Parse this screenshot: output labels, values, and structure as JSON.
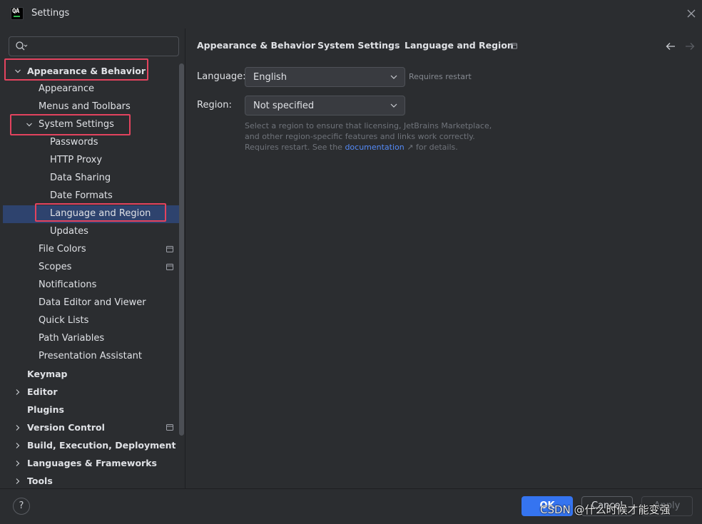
{
  "window": {
    "title": "Settings",
    "app_icon_text": "QA"
  },
  "search": {
    "placeholder": ""
  },
  "tree": [
    {
      "label": "Appearance & Behavior",
      "bold": true,
      "expanded": true
    },
    {
      "label": "Appearance"
    },
    {
      "label": "Menus and Toolbars"
    },
    {
      "label": "System Settings",
      "expanded": true
    },
    {
      "label": "Passwords"
    },
    {
      "label": "HTTP Proxy"
    },
    {
      "label": "Data Sharing"
    },
    {
      "label": "Date Formats"
    },
    {
      "label": "Language and Region",
      "selected": true
    },
    {
      "label": "Updates"
    },
    {
      "label": "File Colors"
    },
    {
      "label": "Scopes"
    },
    {
      "label": "Notifications"
    },
    {
      "label": "Data Editor and Viewer"
    },
    {
      "label": "Quick Lists"
    },
    {
      "label": "Path Variables"
    },
    {
      "label": "Presentation Assistant"
    },
    {
      "label": "Keymap",
      "bold": true
    },
    {
      "label": "Editor",
      "bold": true
    },
    {
      "label": "Plugins",
      "bold": true
    },
    {
      "label": "Version Control",
      "bold": true
    },
    {
      "label": "Build, Execution, Deployment",
      "bold": true
    },
    {
      "label": "Languages & Frameworks",
      "bold": true
    },
    {
      "label": "Tools",
      "bold": true
    }
  ],
  "breadcrumb": [
    "Appearance & Behavior",
    "System Settings",
    "Language and Region"
  ],
  "breadcrumb_separator": "›",
  "language": {
    "label": "Language:",
    "value": "English",
    "hint": "Requires restart"
  },
  "region": {
    "label": "Region:",
    "value": "Not specified"
  },
  "description": {
    "text": "Select a region to ensure that licensing, JetBrains Marketplace, and other region-specific features and links work correctly. Requires restart. See the",
    "link": "documentation",
    "link_arrow": "↗",
    "tail": "for details."
  },
  "footer": {
    "help": "?",
    "ok": "OK",
    "cancel": "Cancel",
    "apply": "Apply"
  },
  "watermark": "CSDN @什么时候才能变强",
  "colors": {
    "accent": "#3574f0",
    "selection": "#2e436e",
    "highlight_box": "#e3435e",
    "link": "#548af7"
  }
}
